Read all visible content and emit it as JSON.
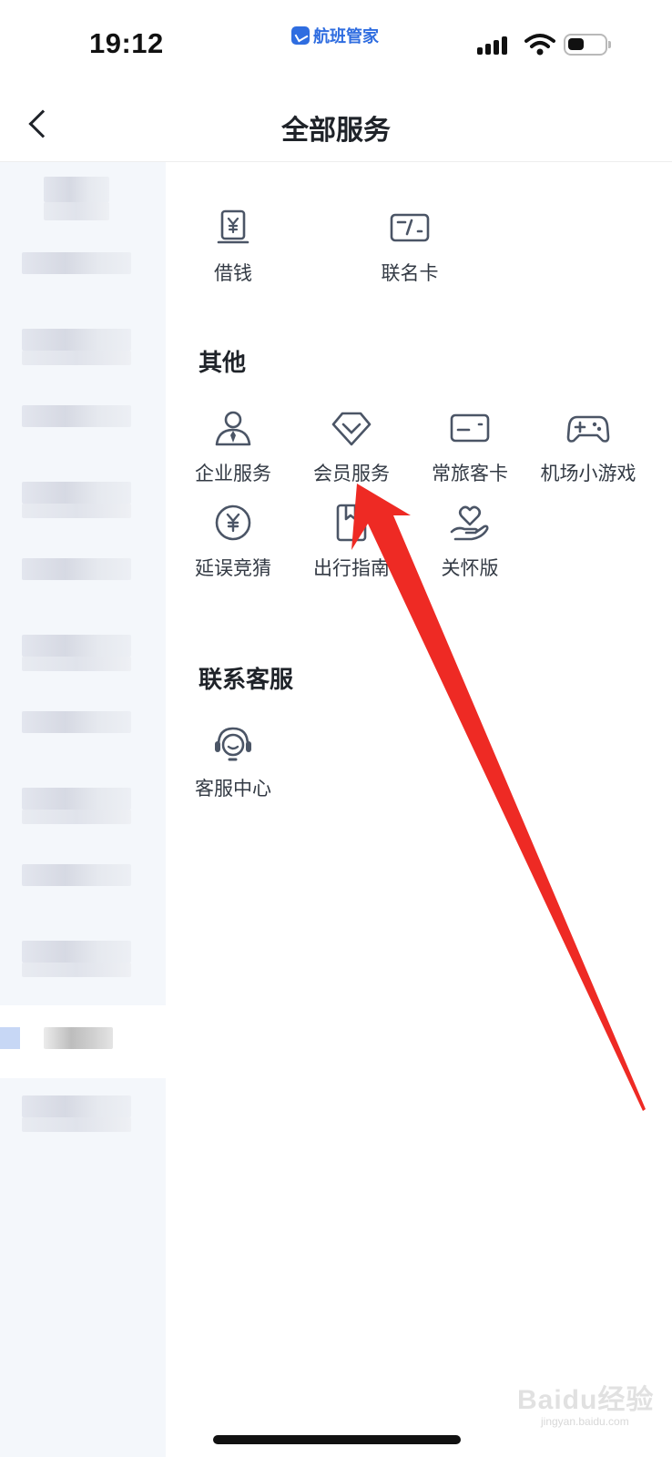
{
  "status_bar": {
    "time": "19:12",
    "app_name": "航班管家",
    "app_icon": "plane-logo-icon",
    "battery_icon": "battery-icon",
    "wifi_icon": "wifi-icon",
    "signal_icon": "signal-icon"
  },
  "nav": {
    "title": "全部服务",
    "back_icon": "chevron-left-icon"
  },
  "sidebar": {
    "items_blurred": true,
    "active_index": 11
  },
  "sections": {
    "top_items": [
      {
        "label": "借钱",
        "icon": "loan-icon"
      },
      {
        "label": "联名卡",
        "icon": "card-icon"
      }
    ],
    "other": {
      "title": "其他",
      "items": [
        {
          "label": "企业服务",
          "icon": "business-person-icon"
        },
        {
          "label": "会员服务",
          "icon": "diamond-icon"
        },
        {
          "label": "常旅客卡",
          "icon": "id-card-icon"
        },
        {
          "label": "机场小游戏",
          "icon": "gamepad-icon"
        },
        {
          "label": "延误竞猜",
          "icon": "yen-coin-icon"
        },
        {
          "label": "出行指南",
          "icon": "bookmark-book-icon"
        },
        {
          "label": "关怀版",
          "icon": "heart-hand-icon"
        }
      ]
    },
    "contact": {
      "title": "联系客服",
      "items": [
        {
          "label": "客服中心",
          "icon": "headset-icon"
        }
      ]
    }
  },
  "annotation": {
    "arrow_color": "#ee2a24",
    "points_to": "会员服务"
  },
  "watermark": {
    "text": "Baidu经验",
    "sub": "jingyan.baidu.com"
  },
  "colors": {
    "accent": "#2f6de0",
    "icon_stroke": "#4b5566",
    "sidebar_bg": "#f4f7fb"
  }
}
